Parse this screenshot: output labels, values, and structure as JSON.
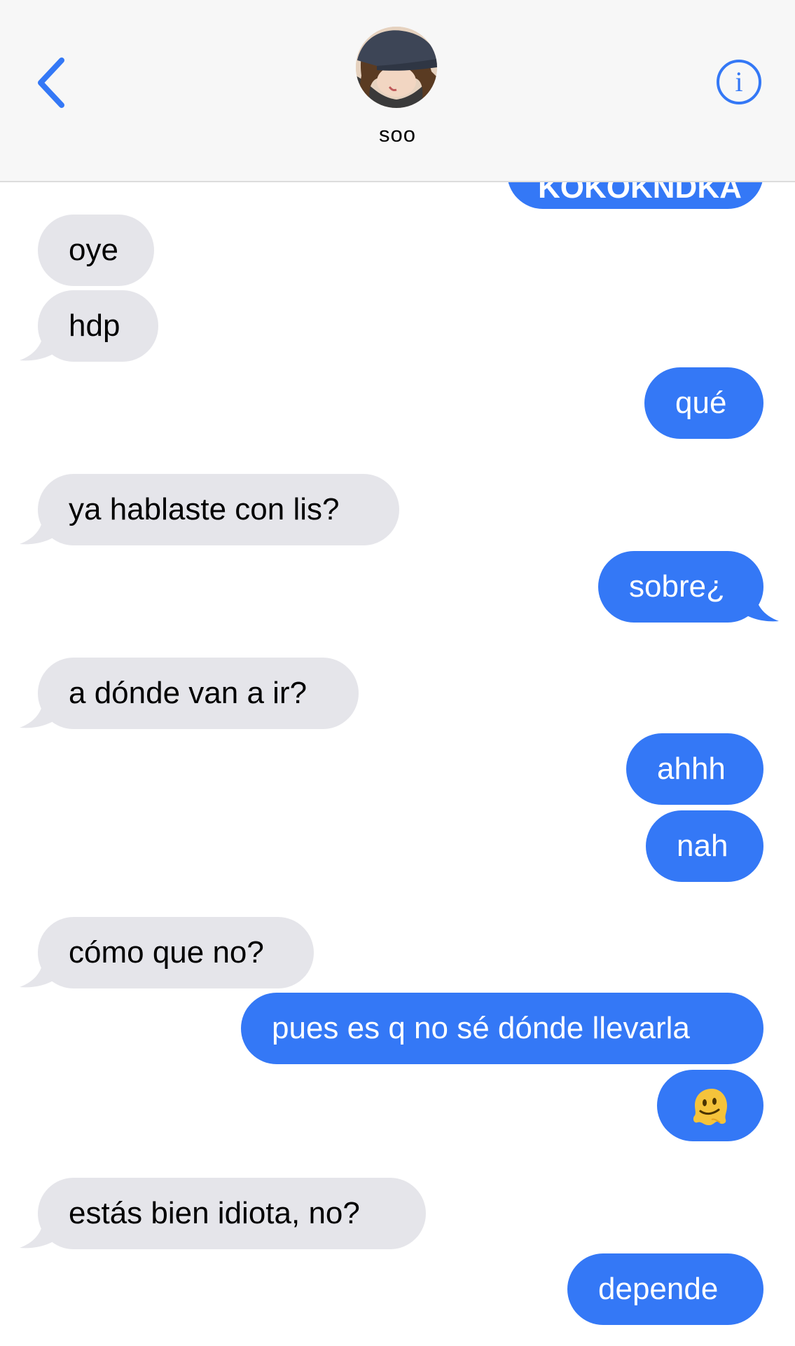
{
  "header": {
    "contact_name": "soo",
    "back_icon": "chevron-left-icon",
    "info_icon": "info-icon",
    "accent": "#3478f6"
  },
  "messages": [
    {
      "from": "me",
      "text": "KOKOKNDKA"
    },
    {
      "from": "them",
      "text": "oye"
    },
    {
      "from": "them",
      "text": "hdp"
    },
    {
      "from": "me",
      "text": "qué"
    },
    {
      "from": "them",
      "text": "ya hablaste con lis?"
    },
    {
      "from": "me",
      "text": "sobre¿"
    },
    {
      "from": "them",
      "text": "a dónde van a ir?"
    },
    {
      "from": "me",
      "text": "ahhh"
    },
    {
      "from": "me",
      "text": "nah"
    },
    {
      "from": "them",
      "text": "cómo que no?"
    },
    {
      "from": "me",
      "text": "pues es q no sé dónde llevarla"
    },
    {
      "from": "me",
      "emoji": "melting-face"
    },
    {
      "from": "them",
      "text": "estás bien idiota, no?"
    },
    {
      "from": "me",
      "text": "depende"
    }
  ],
  "colors": {
    "incoming_bubble": "#e5e5ea",
    "outgoing_bubble": "#3478f6",
    "header_bg": "#f7f7f7"
  }
}
